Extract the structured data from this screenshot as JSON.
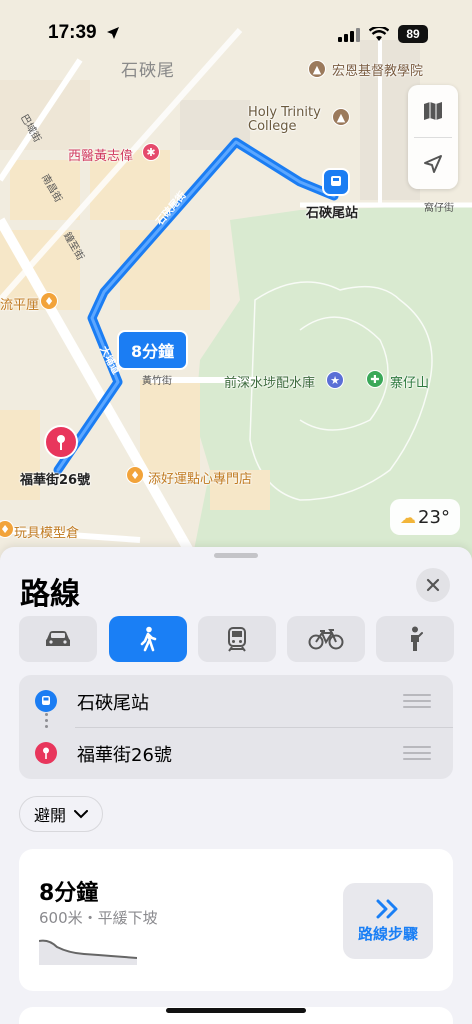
{
  "status_bar": {
    "time": "17:39",
    "battery": "89"
  },
  "map": {
    "area_name": "石硤尾",
    "pois": {
      "kindergarten": "宏恩基督教學院",
      "college": "Holy Trinity\nCollege",
      "doctor": "西醫黃志偉",
      "station": "石硤尾站",
      "reservoir": "前深水埗配水庫",
      "hill": "寨仔山",
      "destination": "福華街26號",
      "bakery": "添好運點心專門店",
      "toy_shop": "玩具模型倉",
      "shop_left": "流平厘"
    },
    "streets": {
      "pak_tin": "巴域街",
      "nam_cheong": "南昌街",
      "yi_tung": "鐘至街",
      "shek_kip_mei": "石硤尾街",
      "tai_hang_tung": "大埔道",
      "wong_chuk": "黃竹街",
      "right_street": "窩仔街"
    },
    "route_time": "8分鐘",
    "weather": "23°",
    "route_color": "#1b7df3"
  },
  "sheet": {
    "title": "路線",
    "modes": [
      {
        "name": "drive",
        "icon": "car-icon"
      },
      {
        "name": "walk",
        "icon": "walk-icon",
        "active": true
      },
      {
        "name": "transit",
        "icon": "train-icon"
      },
      {
        "name": "cycle",
        "icon": "bicycle-icon"
      },
      {
        "name": "rideshare",
        "icon": "person-icon"
      }
    ],
    "stops": {
      "origin": "石硤尾站",
      "destination": "福華街26號"
    },
    "avoid_label": "避開",
    "route": {
      "time": "8分鐘",
      "detail": "600米・平緩下坡",
      "steps_label": "路線步驟"
    },
    "accent": "#1a7ff5"
  }
}
